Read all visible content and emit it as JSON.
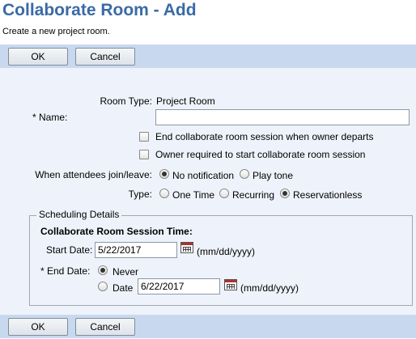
{
  "header": {
    "title": "Collaborate Room - Add",
    "subtitle": "Create a new project room."
  },
  "toolbar": {
    "ok_label": "OK",
    "cancel_label": "Cancel"
  },
  "form": {
    "room_type_label": "Room Type:",
    "room_type_value": "Project Room",
    "name_label": "* Name:",
    "name_value": "",
    "end_session_label": "End collaborate room session when owner departs",
    "end_session_checked": false,
    "owner_required_label": "Owner required to start collaborate room session",
    "owner_required_checked": false,
    "attendees_label": "When attendees join/leave:",
    "attendees_options": [
      "No notification",
      "Play tone"
    ],
    "attendees_selected": "No notification",
    "type_label": "Type:",
    "type_options": [
      "One Time",
      "Recurring",
      "Reservationless"
    ],
    "type_selected": "Reservationless"
  },
  "scheduling": {
    "legend": "Scheduling Details",
    "session_time_label": "Collaborate Room Session Time:",
    "start_date_label": "Start Date:",
    "start_date_value": "5/22/2017",
    "start_date_format": "(mm/dd/yyyy)",
    "end_date_label": "* End Date:",
    "never_label": "Never",
    "date_label": "Date",
    "end_date_selected": "Never",
    "end_date_value": "6/22/2017",
    "end_date_format": "(mm/dd/yyyy)"
  },
  "icons": {
    "calendar": "calendar-icon"
  },
  "colors": {
    "title": "#3a6aa6",
    "toolbar_bg": "#c8d9ef",
    "form_bg": "#eef3fb"
  }
}
